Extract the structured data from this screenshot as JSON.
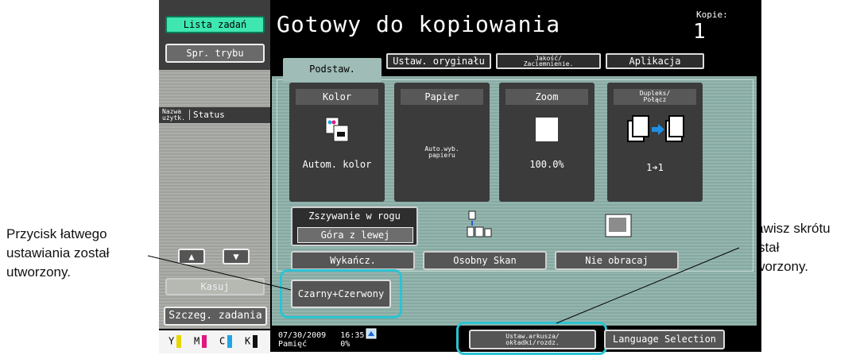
{
  "callouts": {
    "left": [
      "Przycisk łatwego",
      "ustawiania został",
      "utworzony."
    ],
    "right": [
      "Klawisz skrótu",
      "został",
      "utworzony."
    ]
  },
  "sidebar": {
    "jobs_list": "Lista zadań",
    "mode_check": "Spr. trybu",
    "user_label": "Nazwa\nużytk.",
    "status_label": "Status",
    "delete": "Kasuj",
    "job_details": "Szczeg. zadania",
    "toner": [
      {
        "letter": "Y",
        "color": "#e6d600"
      },
      {
        "letter": "M",
        "color": "#e0177f"
      },
      {
        "letter": "C",
        "color": "#1ea7e4"
      },
      {
        "letter": "K",
        "color": "#111111"
      }
    ]
  },
  "header": {
    "title": "Gotowy do kopiowania",
    "copies_label": "Kopie:",
    "copies_value": "1"
  },
  "tabs": {
    "basic": "Podstaw.",
    "original": "Ustaw. oryginału",
    "quality": "Jakość/\nZaciemnienie.",
    "application": "Aplikacja"
  },
  "functions": {
    "color": {
      "label": "Kolor",
      "value": "Autom. kolor"
    },
    "paper": {
      "label": "Papier",
      "value": "Auto.wyb.\npapieru"
    },
    "zoom": {
      "label": "Zoom",
      "value": "100.0%"
    },
    "duplex": {
      "label": "Dupleks/\nPołącz",
      "value": "1➔1"
    }
  },
  "finishing": {
    "staple_title": "Zszywanie w rogu",
    "staple_value": "Góra z lewej",
    "finisher": "Wykańcz.",
    "separate_scan": "Osobny Skan",
    "no_rotate": "Nie obracaj"
  },
  "easy_setting": "Czarny+Czerwony",
  "footer": {
    "date": "07/30/2009",
    "time": "16:35",
    "memory_label": "Pamięć",
    "memory_value": "0%",
    "shortcut": "Ustaw.arkusza/\nokładki/rozdz.",
    "language": "Language Selection"
  },
  "colors": {
    "accent_ring": "#2cc3d3",
    "jobs_button": "#3ee7b0",
    "active_tab": "#9fbcb6"
  }
}
